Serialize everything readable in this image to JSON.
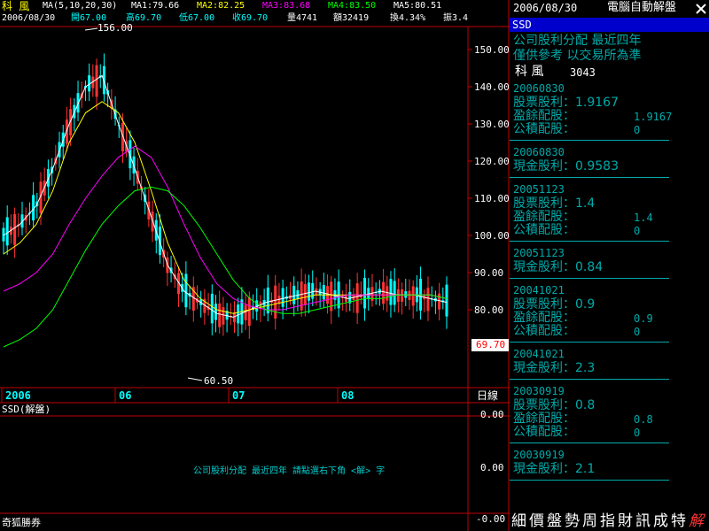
{
  "stock": {
    "name": "科  風",
    "code": "3043"
  },
  "header": {
    "ma_params": "MA(5,10,20,30)",
    "ma1": "MA1:79.66",
    "ma2": "MA2:82.25",
    "ma3": "MA3:83.68",
    "ma4": "MA4:83.50",
    "ma5": "MA5:80.51",
    "date": "2006/08/30",
    "open": "開67.00",
    "high": "高69.70",
    "low": "低67.00",
    "close": "收69.70",
    "volume": "量4741",
    "amount": "額32419",
    "turnover": "換4.34%",
    "amplitude": "振3.4"
  },
  "chart": {
    "y_ticks": [
      "150.00",
      "140.00",
      "130.00",
      "120.00",
      "110.00",
      "100.00",
      "90.00",
      "80.00"
    ],
    "x_ticks": [
      "2006",
      "06",
      "07",
      "08"
    ],
    "period": "日線",
    "high_label": "156.00",
    "low_label": "60.50",
    "price_tag": "69.70",
    "colors": {
      "up": "#ff3333",
      "down": "#00ffff",
      "ma1": "#ffffff",
      "ma2": "#ffff00",
      "ma3": "#ff00ff",
      "ma4": "#00ff00"
    }
  },
  "chart_data": {
    "type": "line",
    "series": [
      {
        "name": "MA1",
        "values": [
          100,
          103,
          108,
          118,
          130,
          140,
          143,
          130,
          118,
          105,
          92,
          85,
          82,
          79,
          78,
          80,
          82,
          83,
          84,
          85,
          84,
          83,
          84,
          85,
          84,
          84,
          83,
          82
        ]
      },
      {
        "name": "MA2",
        "values": [
          95,
          98,
          103,
          112,
          125,
          133,
          136,
          133,
          125,
          112,
          98,
          88,
          83,
          80,
          79,
          80,
          81,
          82,
          83,
          84,
          84,
          84,
          84,
          84,
          84,
          84,
          84,
          83
        ]
      },
      {
        "name": "MA3",
        "values": [
          85,
          87,
          90,
          95,
          103,
          110,
          116,
          121,
          124,
          121,
          113,
          103,
          94,
          87,
          83,
          81,
          80,
          80,
          81,
          82,
          83,
          84,
          84,
          84,
          84,
          84,
          84,
          83
        ]
      },
      {
        "name": "MA4",
        "values": [
          70,
          72,
          75,
          80,
          88,
          96,
          103,
          108,
          112,
          113,
          112,
          108,
          102,
          95,
          88,
          83,
          80,
          79,
          79,
          80,
          81,
          82,
          83,
          83,
          84,
          84,
          84,
          83
        ]
      }
    ]
  },
  "indicator": {
    "title": "SSD(解盤)",
    "ticks": [
      "0.00",
      "0.00",
      "-0.00"
    ],
    "note": "公司股利分配  最近四年   請點選右下角 <解> 字"
  },
  "footer": {
    "broker": "奇狐勝券"
  },
  "panel": {
    "date": "2006/08/30",
    "app_title": "電腦自動解盤",
    "ssd": "SSD",
    "heading1": "公司股利分配  最近四年",
    "heading2": "僅供參考  以交易所為準",
    "records": [
      {
        "date": "20060830",
        "rows": [
          [
            "股票股利",
            "1.9167"
          ],
          [
            "盈餘配股",
            "1.9167"
          ],
          [
            "公積配股",
            "0"
          ]
        ]
      },
      {
        "date": "20060830",
        "rows": [
          [
            "現金股利",
            "0.9583"
          ]
        ]
      },
      {
        "date": "20051123",
        "rows": [
          [
            "股票股利",
            "1.4"
          ],
          [
            "盈餘配股",
            "1.4"
          ],
          [
            "公積配股",
            "0"
          ]
        ]
      },
      {
        "date": "20051123",
        "rows": [
          [
            "現金股利",
            "0.84"
          ]
        ]
      },
      {
        "date": "20041021",
        "rows": [
          [
            "股票股利",
            "0.9"
          ],
          [
            "盈餘配股",
            "0.9"
          ],
          [
            "公積配股",
            "0"
          ]
        ]
      },
      {
        "date": "20041021",
        "rows": [
          [
            "現金股利",
            "2.3"
          ]
        ]
      },
      {
        "date": "20030919",
        "rows": [
          [
            "股票股利",
            "0.8"
          ],
          [
            "盈餘配股",
            "0.8"
          ],
          [
            "公積配股",
            "0"
          ]
        ]
      },
      {
        "date": "20030919",
        "rows": [
          [
            "現金股利",
            "2.1"
          ]
        ]
      }
    ],
    "tabs": [
      "細",
      "價",
      "盤",
      "勢",
      "周",
      "指",
      "財",
      "訊",
      "成",
      "特",
      "解"
    ]
  }
}
